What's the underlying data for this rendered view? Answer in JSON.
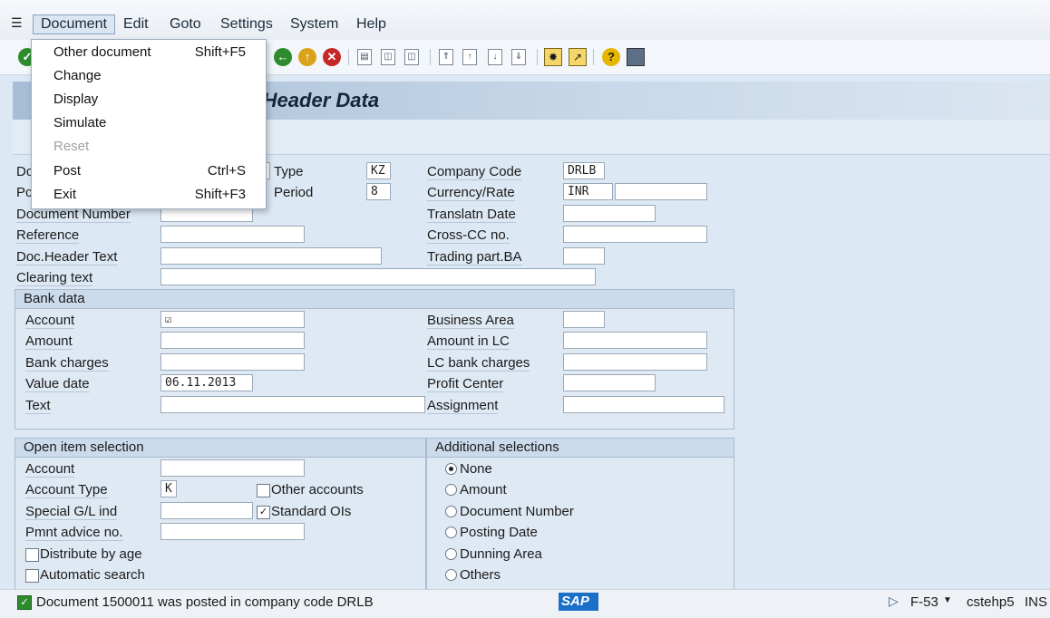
{
  "menubar": {
    "items": [
      "Document",
      "Edit",
      "Goto",
      "Settings",
      "System",
      "Help"
    ]
  },
  "dropdown": {
    "items": [
      {
        "label": "Other document",
        "shortcut": "Shift+F5",
        "enabled": true
      },
      {
        "label": "Change",
        "shortcut": "",
        "enabled": true
      },
      {
        "label": "Display",
        "shortcut": "",
        "enabled": true
      },
      {
        "label": "Simulate",
        "shortcut": "",
        "enabled": true
      },
      {
        "label": "Reset",
        "shortcut": "",
        "enabled": false
      },
      {
        "label": "Post",
        "shortcut": "Ctrl+S",
        "enabled": true
      },
      {
        "label": "Exit",
        "shortcut": "Shift+F3",
        "enabled": true
      }
    ]
  },
  "title": "s: Header Data",
  "header": {
    "left_labels": [
      "Dc",
      "Pc",
      "Document Number",
      "Reference",
      "Doc.Header Text",
      "Clearing text"
    ],
    "type_label": "Type",
    "type_value": "KZ",
    "period_label": "Period",
    "period_value": "8",
    "company_code_label": "Company Code",
    "company_code_value": "DRLB",
    "currency_label": "Currency/Rate",
    "currency_value": "INR",
    "translatn_label": "Translatn Date",
    "crosscc_label": "Cross-CC no.",
    "trading_label": "Trading part.BA"
  },
  "bank": {
    "title": "Bank data",
    "left_labels": [
      "Account",
      "Amount",
      "Bank charges",
      "Value date",
      "Text"
    ],
    "value_date": "06.11.2013",
    "right_labels": [
      "Business Area",
      "Amount in LC",
      "LC bank charges",
      "Profit Center",
      "Assignment"
    ]
  },
  "open_item": {
    "title": "Open item selection",
    "labels": [
      "Account",
      "Account Type",
      "Special G/L ind",
      "Pmnt advice no."
    ],
    "account_type_value": "K",
    "other_accounts": "Other accounts",
    "standard_ois": "Standard OIs",
    "distribute": "Distribute by age",
    "automatic": "Automatic search"
  },
  "additional": {
    "title": "Additional selections",
    "options": [
      "None",
      "Amount",
      "Document Number",
      "Posting Date",
      "Dunning Area",
      "Others"
    ],
    "selected": 0
  },
  "status": {
    "message": "Document 1500011 was posted in company code DRLB",
    "logo": "SAP",
    "transaction": "F-53",
    "server": "cstehp5",
    "mode": "INS"
  },
  "colors": {
    "success": "#2e8b2e",
    "title_bg": "#a8bed6"
  }
}
